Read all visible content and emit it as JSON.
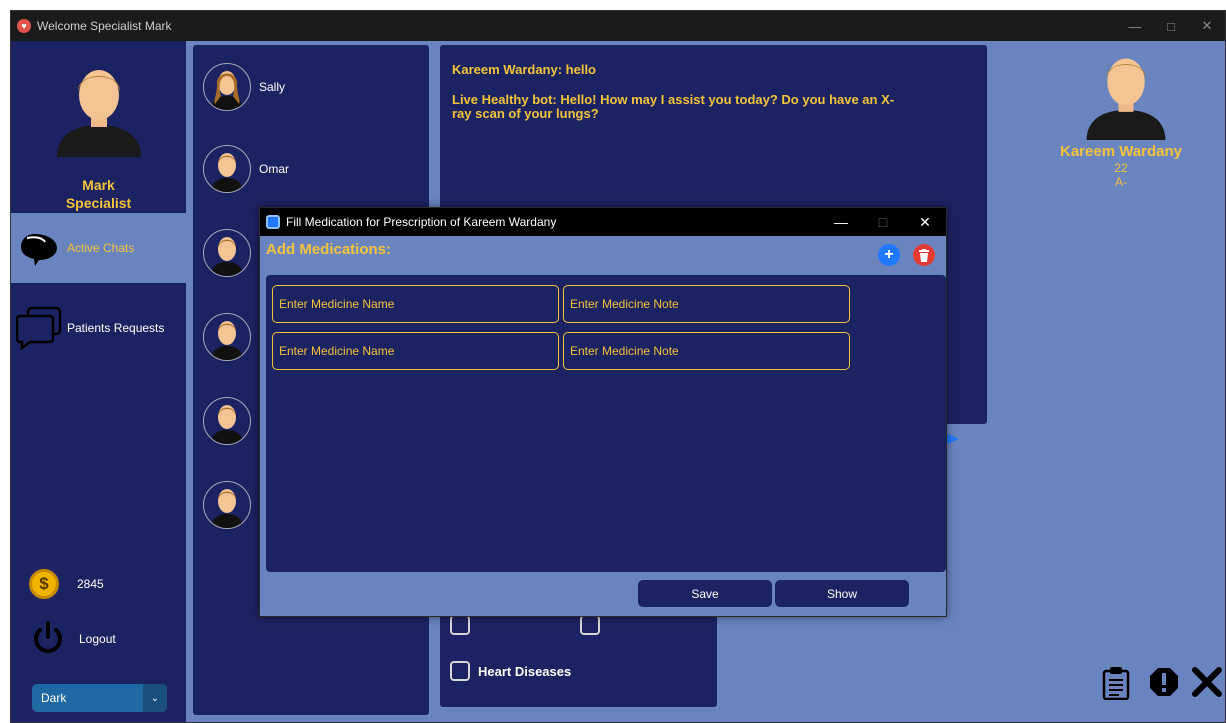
{
  "window": {
    "title": "Welcome Specialist Mark"
  },
  "sidebar": {
    "profile_name": "Mark",
    "profile_role": "Specialist",
    "nav": [
      {
        "label": "Active Chats",
        "icon": "chat-bubbles-icon",
        "active": true
      },
      {
        "label": "Patients Requests",
        "icon": "requests-icon",
        "active": false
      }
    ],
    "coins": "2845",
    "logout_label": "Logout",
    "theme_value": "Dark"
  },
  "contacts": [
    {
      "name": "Sally"
    },
    {
      "name": "Omar"
    },
    {
      "name": ""
    },
    {
      "name": ""
    },
    {
      "name": ""
    },
    {
      "name": ""
    }
  ],
  "chat": {
    "messages": [
      {
        "text": "Kareem Wardany: hello"
      },
      {
        "text": "Live Healthy bot: Hello! How may I assist you today? Do you have an X-ray scan of your lungs?"
      }
    ]
  },
  "disease": {
    "heart_label": "Heart Diseases"
  },
  "patient": {
    "name": "Kareem Wardany",
    "age": "22",
    "blood_type": "A-"
  },
  "dialog": {
    "title": "Fill Medication for Prescription of Kareem Wardany",
    "heading": "Add Medications:",
    "rows": [
      {
        "name_placeholder": "Enter Medicine Name",
        "note_placeholder": "Enter Medicine Note"
      },
      {
        "name_placeholder": "Enter Medicine Name",
        "note_placeholder": "Enter Medicine Note"
      }
    ],
    "save_label": "Save",
    "show_label": "Show"
  },
  "colors": {
    "panel": "#1c2362",
    "background": "#6a84c0",
    "accent": "#f3c43a",
    "add": "#1f79ff",
    "delete": "#e53935"
  }
}
